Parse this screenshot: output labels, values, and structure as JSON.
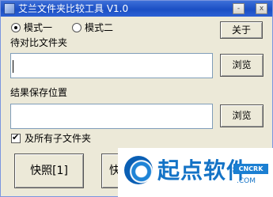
{
  "window": {
    "title": "艾兰文件夹比较工具 V1.0"
  },
  "titlebar_buttons": {
    "minimize": "-",
    "close": "x"
  },
  "mode": {
    "option1": "模式一",
    "option2": "模式二",
    "selected": "模式一"
  },
  "about_label": "关于",
  "compare_folder": {
    "label": "待对比文件夹",
    "value": "",
    "browse_label": "浏览"
  },
  "result_location": {
    "label": "结果保存位置",
    "value": "",
    "browse_label": "浏览"
  },
  "include_subfolders": {
    "label": "及所有子文件夹",
    "checked": true
  },
  "actions": {
    "snapshot1": "快照[1]",
    "snapshot2_partial": "快"
  },
  "watermark": {
    "text": "起点软件",
    "badge": "CNCRK",
    "url": ".COM"
  }
}
